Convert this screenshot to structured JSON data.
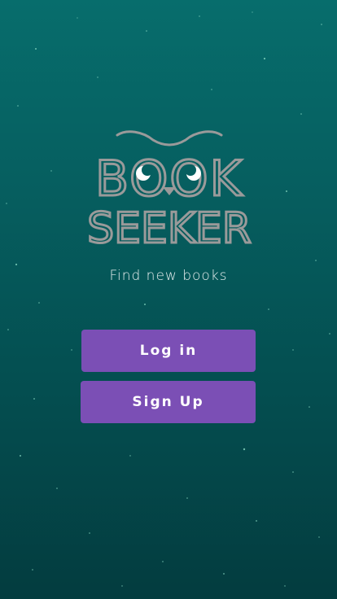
{
  "app": {
    "logo_line1": "BOOK",
    "logo_line2": "SEEKER",
    "tagline": "Find new books"
  },
  "actions": {
    "login_label": "Log in",
    "signup_label": "Sign Up"
  },
  "colors": {
    "background_top": "#076d6c",
    "background_bottom": "#033c3f",
    "logo_gray": "#9a9a9a",
    "button_purple": "#7b4fb5",
    "button_text": "#ffffff"
  },
  "icons": [
    "owl-logo-icon"
  ]
}
